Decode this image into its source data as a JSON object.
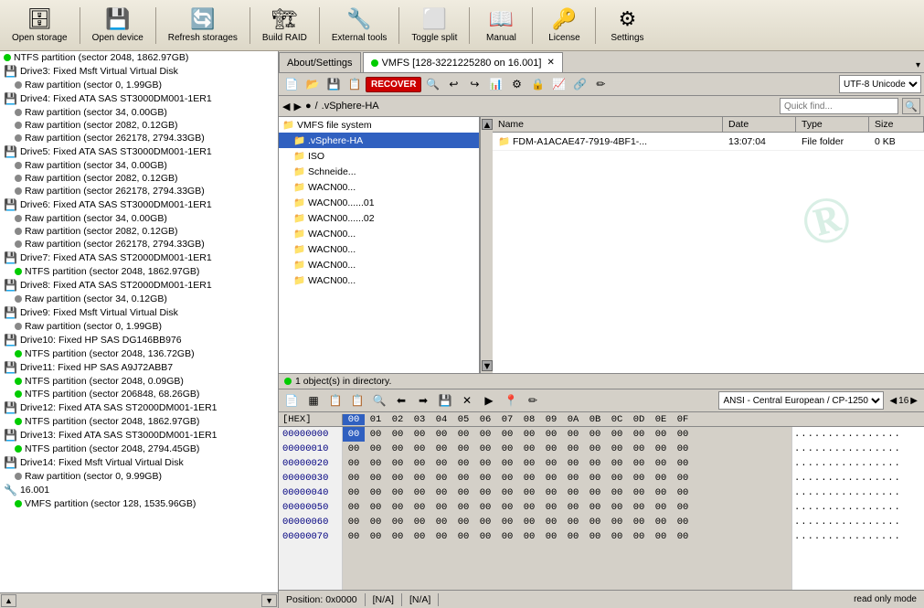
{
  "toolbar": {
    "items": [
      {
        "id": "open-storage",
        "label": "Open storage",
        "icon": "🗄"
      },
      {
        "id": "open-device",
        "label": "Open device",
        "icon": "💾"
      },
      {
        "id": "refresh-storages",
        "label": "Refresh storages",
        "icon": "🔄"
      },
      {
        "id": "build-raid",
        "label": "Build RAID",
        "icon": "🏗"
      },
      {
        "id": "external-tools",
        "label": "External tools",
        "icon": "🔧"
      },
      {
        "id": "toggle-split",
        "label": "Toggle split",
        "icon": "⬜"
      },
      {
        "id": "manual",
        "label": "Manual",
        "icon": "📖"
      },
      {
        "id": "license",
        "label": "License",
        "icon": "🔑"
      },
      {
        "id": "settings",
        "label": "Settings",
        "icon": "⚙"
      }
    ]
  },
  "left_panel": {
    "items": [
      {
        "text": "NTFS partition (sector 2048, 1862.97GB)",
        "indent": 0,
        "dot": "green",
        "icon": ""
      },
      {
        "text": "Drive3: Fixed Msft Virtual Virtual Disk",
        "indent": 0,
        "dot": null,
        "icon": "💾"
      },
      {
        "text": "Raw partition (sector 0, 1.99GB)",
        "indent": 1,
        "dot": "gray",
        "icon": ""
      },
      {
        "text": "Drive4: Fixed ATA SAS ST3000DM001-1ER1",
        "indent": 0,
        "dot": null,
        "icon": "💾"
      },
      {
        "text": "Raw partition (sector 34, 0.00GB)",
        "indent": 1,
        "dot": "gray",
        "icon": ""
      },
      {
        "text": "Raw partition (sector 2082, 0.12GB)",
        "indent": 1,
        "dot": "gray",
        "icon": ""
      },
      {
        "text": "Raw partition (sector 262178, 2794.33GB)",
        "indent": 1,
        "dot": "gray",
        "icon": ""
      },
      {
        "text": "Drive5: Fixed ATA SAS ST3000DM001-1ER1",
        "indent": 0,
        "dot": null,
        "icon": "💾"
      },
      {
        "text": "Raw partition (sector 34, 0.00GB)",
        "indent": 1,
        "dot": "gray",
        "icon": ""
      },
      {
        "text": "Raw partition (sector 2082, 0.12GB)",
        "indent": 1,
        "dot": "gray",
        "icon": ""
      },
      {
        "text": "Raw partition (sector 262178, 2794.33GB)",
        "indent": 1,
        "dot": "gray",
        "icon": ""
      },
      {
        "text": "Drive6: Fixed ATA SAS ST3000DM001-1ER1",
        "indent": 0,
        "dot": null,
        "icon": "💾"
      },
      {
        "text": "Raw partition (sector 34, 0.00GB)",
        "indent": 1,
        "dot": "gray",
        "icon": ""
      },
      {
        "text": "Raw partition (sector 2082, 0.12GB)",
        "indent": 1,
        "dot": "gray",
        "icon": ""
      },
      {
        "text": "Raw partition (sector 262178, 2794.33GB)",
        "indent": 1,
        "dot": "highlighted gray",
        "icon": ""
      },
      {
        "text": "Drive7: Fixed ATA SAS ST2000DM001-1ER1",
        "indent": 0,
        "dot": null,
        "icon": "💾"
      },
      {
        "text": "NTFS partition (sector 2048, 1862.97GB)",
        "indent": 1,
        "dot": "green",
        "icon": ""
      },
      {
        "text": "Drive8: Fixed ATA SAS ST2000DM001-1ER1",
        "indent": 0,
        "dot": null,
        "icon": "💾"
      },
      {
        "text": "Raw partition (sector 34, 0.12GB)",
        "indent": 1,
        "dot": "gray",
        "icon": ""
      },
      {
        "text": "Drive9: Fixed Msft Virtual Virtual Disk",
        "indent": 0,
        "dot": null,
        "icon": "💾"
      },
      {
        "text": "Raw partition (sector 0, 1.99GB)",
        "indent": 1,
        "dot": "gray",
        "icon": ""
      },
      {
        "text": "Drive10: Fixed HP SAS DG146BB976",
        "indent": 0,
        "dot": null,
        "icon": "💾"
      },
      {
        "text": "NTFS partition (sector 2048, 136.72GB)",
        "indent": 1,
        "dot": "green",
        "icon": ""
      },
      {
        "text": "Drive11: Fixed HP SAS A9J72ABB7",
        "indent": 0,
        "dot": null,
        "icon": "💾"
      },
      {
        "text": "NTFS partition (sector 2048, 0.09GB)",
        "indent": 1,
        "dot": "green",
        "icon": ""
      },
      {
        "text": "NTFS partition (sector 206848, 68.26GB)",
        "indent": 1,
        "dot": "green",
        "icon": ""
      },
      {
        "text": "Drive12: Fixed ATA SAS ST2000DM001-1ER1",
        "indent": 0,
        "dot": null,
        "icon": "💾"
      },
      {
        "text": "NTFS partition (sector 2048, 1862.97GB)",
        "indent": 1,
        "dot": "green",
        "icon": ""
      },
      {
        "text": "Drive13: Fixed ATA SAS ST3000DM001-1ER1",
        "indent": 0,
        "dot": null,
        "icon": "💾"
      },
      {
        "text": "NTFS partition (sector 2048, 2794.45GB)",
        "indent": 1,
        "dot": "green",
        "icon": ""
      },
      {
        "text": "Drive14: Fixed Msft Virtual Virtual Disk",
        "indent": 0,
        "dot": null,
        "icon": "💾"
      },
      {
        "text": "Raw partition (sector 0, 9.99GB)",
        "indent": 1,
        "dot": "gray",
        "icon": ""
      },
      {
        "text": "16.001",
        "indent": 0,
        "dot": null,
        "icon": "🔧"
      },
      {
        "text": "VMFS partition (sector 128, 1535.96GB)",
        "indent": 1,
        "dot": "green",
        "icon": ""
      }
    ]
  },
  "tabs": [
    {
      "label": "About/Settings",
      "active": false,
      "dot": false,
      "closeable": false
    },
    {
      "label": "VMFS [128-3221225280 on 16.001]",
      "active": true,
      "dot": true,
      "closeable": true
    }
  ],
  "file_toolbar_buttons": [
    "⬅",
    "➡",
    "⬆",
    "🔼",
    "🏠",
    "💾",
    "📋",
    "📂",
    "🔍",
    "↩",
    "↪",
    "📄",
    "⚙",
    "🔒",
    "📊",
    "📈",
    "📉",
    "🔗",
    "✏"
  ],
  "recover_btn": "RECOVER",
  "encoding": "UTF-8 Unicode",
  "path": {
    "separator": "/",
    "segments": [
      "●",
      ".vSphere-HA"
    ]
  },
  "quick_find_placeholder": "Quick find...",
  "file_tree": {
    "items": [
      {
        "label": "VMFS file system",
        "indent": 0,
        "expanded": true,
        "icon": "📁"
      },
      {
        "label": ".vSphere-HA",
        "indent": 1,
        "selected": true,
        "icon": "📁"
      },
      {
        "label": "ISO",
        "indent": 1,
        "selected": false,
        "icon": "📁"
      },
      {
        "label": "Schneide...",
        "indent": 1,
        "selected": false,
        "icon": "📁"
      },
      {
        "label": "WACN00...",
        "indent": 1,
        "selected": false,
        "icon": "📁"
      },
      {
        "label": "WACN00...",
        "indent": 1,
        "selected": false,
        "icon": "📁",
        "suffix": "...01"
      },
      {
        "label": "WACN00...",
        "indent": 1,
        "selected": false,
        "icon": "📁",
        "suffix": "...02"
      },
      {
        "label": "WACN00...",
        "indent": 1,
        "selected": false,
        "icon": "📁"
      },
      {
        "label": "WACN00...",
        "indent": 1,
        "selected": false,
        "icon": "📁"
      },
      {
        "label": "WACN00...",
        "indent": 1,
        "selected": false,
        "icon": "📁"
      },
      {
        "label": "WACN00...",
        "indent": 1,
        "selected": false,
        "icon": "📁"
      }
    ]
  },
  "file_list": {
    "columns": [
      "Name",
      "Date",
      "Type",
      "Size"
    ],
    "rows": [
      {
        "name": "FDM-A1ACAE47-7919-4BF1-...",
        "date": "13:07:04",
        "type": "File folder",
        "size": "0 KB",
        "icon": "📁"
      }
    ]
  },
  "status_objects": "1 object(s) in directory.",
  "hex_editor": {
    "ansi": "ANSI - Central European / CP-1250",
    "page_size": 16,
    "header_bytes": [
      "00",
      "01",
      "02",
      "03",
      "04",
      "05",
      "06",
      "07",
      "08",
      "09",
      "0A",
      "0B",
      "0C",
      "0D",
      "0E",
      "0F"
    ],
    "rows": [
      {
        "addr": "00000000",
        "bytes": [
          "00",
          "00",
          "00",
          "00",
          "00",
          "00",
          "00",
          "00",
          "00",
          "00",
          "00",
          "00",
          "00",
          "00",
          "00",
          "00"
        ],
        "ascii": "................"
      },
      {
        "addr": "00000010",
        "bytes": [
          "00",
          "00",
          "00",
          "00",
          "00",
          "00",
          "00",
          "00",
          "00",
          "00",
          "00",
          "00",
          "00",
          "00",
          "00",
          "00"
        ],
        "ascii": "................"
      },
      {
        "addr": "00000020",
        "bytes": [
          "00",
          "00",
          "00",
          "00",
          "00",
          "00",
          "00",
          "00",
          "00",
          "00",
          "00",
          "00",
          "00",
          "00",
          "00",
          "00"
        ],
        "ascii": "................"
      },
      {
        "addr": "00000030",
        "bytes": [
          "00",
          "00",
          "00",
          "00",
          "00",
          "00",
          "00",
          "00",
          "00",
          "00",
          "00",
          "00",
          "00",
          "00",
          "00",
          "00"
        ],
        "ascii": "................"
      },
      {
        "addr": "00000040",
        "bytes": [
          "00",
          "00",
          "00",
          "00",
          "00",
          "00",
          "00",
          "00",
          "00",
          "00",
          "00",
          "00",
          "00",
          "00",
          "00",
          "00"
        ],
        "ascii": "................"
      },
      {
        "addr": "00000050",
        "bytes": [
          "00",
          "00",
          "00",
          "00",
          "00",
          "00",
          "00",
          "00",
          "00",
          "00",
          "00",
          "00",
          "00",
          "00",
          "00",
          "00"
        ],
        "ascii": "................"
      },
      {
        "addr": "00000060",
        "bytes": [
          "00",
          "00",
          "00",
          "00",
          "00",
          "00",
          "00",
          "00",
          "00",
          "00",
          "00",
          "00",
          "00",
          "00",
          "00",
          "00"
        ],
        "ascii": "................"
      },
      {
        "addr": "00000070",
        "bytes": [
          "00",
          "00",
          "00",
          "00",
          "00",
          "00",
          "00",
          "00",
          "00",
          "00",
          "00",
          "00",
          "00",
          "00",
          "00",
          "00"
        ],
        "ascii": "................"
      }
    ],
    "selected_byte": {
      "row": 0,
      "col": 0
    }
  },
  "bottom_status": {
    "position": "Position: 0x0000",
    "na1": "[N/A]",
    "na2": "[N/A]",
    "read_only": "read only mode"
  }
}
